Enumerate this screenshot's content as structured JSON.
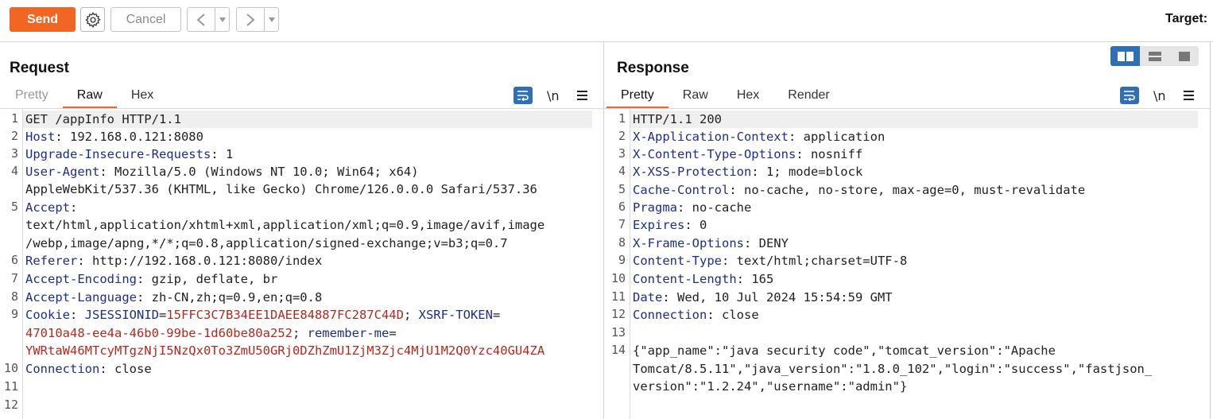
{
  "toolbar": {
    "send_label": "Send",
    "cancel_label": "Cancel",
    "target_label": "Target:"
  },
  "request": {
    "title": "Request",
    "tabs": [
      "Pretty",
      "Raw",
      "Hex"
    ],
    "active_tab": "Raw",
    "line_numbers": [
      "1",
      "2",
      "3",
      "4",
      "5",
      "6",
      "7",
      "8",
      "9",
      "10",
      "11",
      "12"
    ],
    "lines": {
      "l1": "GET /appInfo HTTP/1.1",
      "l2_key": "Host",
      "l2_val": ": 192.168.0.121:8080",
      "l3_key": "Upgrade-Insecure-Requests",
      "l3_val": ": 1",
      "l4_key": "User-Agent",
      "l4_val": ": Mozilla/5.0 (Windows NT 10.0; Win64; x64)",
      "l4_cont": "AppleWebKit/537.36 (KHTML, like Gecko) Chrome/126.0.0.0 Safari/537.36",
      "l5_key": "Accept",
      "l5_val": ":",
      "l5_cont1": "text/html,application/xhtml+xml,application/xml;q=0.9,image/avif,image",
      "l5_cont2": "/webp,image/apng,*/*;q=0.8,application/signed-exchange;v=b3;q=0.7",
      "l6_key": "Referer",
      "l6_val": ": http://192.168.0.121:8080/index",
      "l7_key": "Accept-Encoding",
      "l7_val": ": gzip, deflate, br",
      "l8_key": "Accept-Language",
      "l8_val": ": zh-CN,zh;q=0.9,en;q=0.8",
      "l9_key": "Cookie",
      "l9_sep1": ": ",
      "l9_c1_name": "JSESSIONID",
      "l9_c1_eq": "=",
      "l9_c1_val": "15FFC3C7B34EE1DAEE84887FC287C44D",
      "l9_semi1": "; ",
      "l9_c2_name": "XSRF-TOKEN",
      "l9_c2_eq": "=",
      "l9_c2_val": "47010a48-ee4a-46b0-99be-1d60be80a252",
      "l9_semi2": "; ",
      "l9_c3_name": "remember-me",
      "l9_c3_eq": "=",
      "l9_c3_val": "YWRtaW46MTcyMTgzNjI5NzQx0To3ZmU50GRj0DZhZmU1ZjM3Zjc4MjU1M2Q0Yzc40GU4ZA",
      "l10_key": "Connection",
      "l10_val": ": close"
    }
  },
  "response": {
    "title": "Response",
    "tabs": [
      "Pretty",
      "Raw",
      "Hex",
      "Render"
    ],
    "active_tab": "Pretty",
    "line_numbers": [
      "1",
      "2",
      "3",
      "4",
      "5",
      "6",
      "7",
      "8",
      "9",
      "10",
      "11",
      "12",
      "13",
      "14"
    ],
    "lines": {
      "l1": "HTTP/1.1 200",
      "l2_key": "X-Application-Context",
      "l2_val": ": application",
      "l3_key": "X-Content-Type-Options",
      "l3_val": ": nosniff",
      "l4_key": "X-XSS-Protection",
      "l4_val": ": 1; mode=block",
      "l5_key": "Cache-Control",
      "l5_val": ": no-cache, no-store, max-age=0, must-revalidate",
      "l6_key": "Pragma",
      "l6_val": ": no-cache",
      "l7_key": "Expires",
      "l7_val": ": 0",
      "l8_key": "X-Frame-Options",
      "l8_val": ": DENY",
      "l9_key": "Content-Type",
      "l9_val": ": text/html;charset=UTF-8",
      "l10_key": "Content-Length",
      "l10_val": ": 165",
      "l11_key": "Date",
      "l11_val": ": Wed, 10 Jul 2024 15:54:59 GMT",
      "l12_key": "Connection",
      "l12_val": ": close",
      "l14_a": "{\"app_name\":\"java security code\",\"tomcat_version\":\"Apache",
      "l14_b": "Tomcat/8.5.11\",\"java_version\":\"1.8.0_102\",\"login\":\"success\",\"fastjson_",
      "l14_c": "version\":\"1.2.24\",\"username\":\"admin\"}"
    }
  },
  "colors": {
    "accent": "#f26522",
    "header_key": "#1e2d8c",
    "cookie_value": "#b5281e",
    "icon_blue": "#2f6fb3"
  },
  "icons": {
    "settings": "gear-icon",
    "back": "chevron-left-icon",
    "forward": "chevron-right-icon",
    "wrap": "word-wrap-icon",
    "newline": "newline-icon",
    "menu": "hamburger-menu-icon",
    "layout": [
      "split-view-icon",
      "horizontal-view-icon",
      "single-view-icon"
    ]
  }
}
